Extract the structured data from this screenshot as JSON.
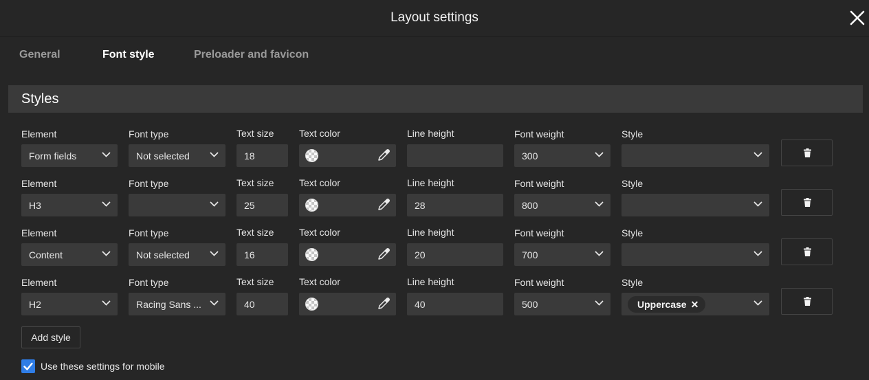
{
  "header": {
    "title": "Layout settings"
  },
  "tabs": [
    {
      "label": "General"
    },
    {
      "label": "Font style"
    },
    {
      "label": "Preloader and favicon"
    }
  ],
  "active_tab": "Font style",
  "section": {
    "title": "Styles"
  },
  "labels": {
    "element": "Element",
    "font_type": "Font type",
    "text_size": "Text size",
    "text_color": "Text color",
    "line_height": "Line height",
    "font_weight": "Font weight",
    "style": "Style"
  },
  "rows": [
    {
      "element": "Form fields",
      "font_type": "Not selected",
      "text_size": "18",
      "line_height": "",
      "font_weight": "300",
      "style_tag": ""
    },
    {
      "element": "H3",
      "font_type": "",
      "text_size": "25",
      "line_height": "28",
      "font_weight": "800",
      "style_tag": ""
    },
    {
      "element": "Content",
      "font_type": "Not selected",
      "text_size": "16",
      "line_height": "20",
      "font_weight": "700",
      "style_tag": ""
    },
    {
      "element": "H2",
      "font_type": "Racing Sans ...",
      "text_size": "40",
      "line_height": "40",
      "font_weight": "500",
      "style_tag": "Uppercase"
    }
  ],
  "add_style_label": "Add style",
  "mobile_checkbox": {
    "label": "Use these settings for mobile",
    "checked": true
  },
  "colors": {
    "background": "#262626",
    "field": "#3a3a3a",
    "section": "#3a3a3a",
    "accent": "#2f7de6"
  },
  "icons": [
    "close-icon",
    "chevron-down-icon",
    "eyedropper-icon",
    "trash-icon",
    "checkmark-icon"
  ]
}
